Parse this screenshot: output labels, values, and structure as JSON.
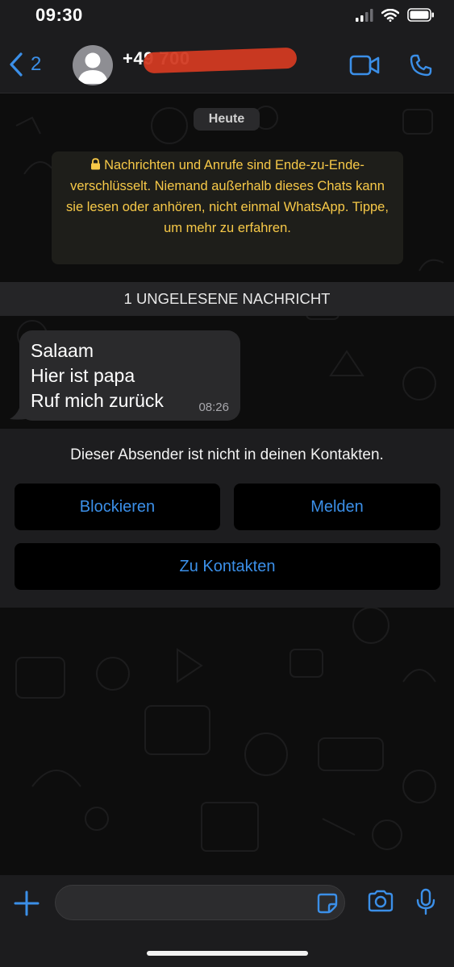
{
  "status_bar": {
    "time": "09:30"
  },
  "header": {
    "back_count": "2",
    "contact_name": "+49           700"
  },
  "chat": {
    "date_chip": "Heute",
    "encryption_notice": "Nachrichten und Anrufe sind Ende-zu-Ende-verschlüsselt. Niemand außerhalb dieses Chats kann sie lesen oder anhören, nicht einmal WhatsApp. Tippe, um mehr zu erfahren.",
    "unread_banner": "1 UNGELESENE NACHRICHT",
    "message": {
      "lines": [
        "Salaam",
        "Hier ist papa",
        "Ruf mich zurück"
      ],
      "time": "08:26"
    }
  },
  "unknown_sender": {
    "notice": "Dieser Absender ist nicht in deinen Kontakten.",
    "block_label": "Blockieren",
    "report_label": "Melden",
    "add_contact_label": "Zu Kontakten"
  },
  "composer": {
    "placeholder": ""
  },
  "colors": {
    "accent": "#3b8fe8",
    "notice_text": "#f7c948",
    "redaction": "#d23a22"
  },
  "icons": [
    "back-chevron-icon",
    "avatar-icon",
    "video-call-icon",
    "phone-call-icon",
    "lock-icon",
    "plus-icon",
    "sticker-icon",
    "camera-icon",
    "microphone-icon",
    "signal-icon",
    "wifi-icon",
    "battery-icon"
  ]
}
